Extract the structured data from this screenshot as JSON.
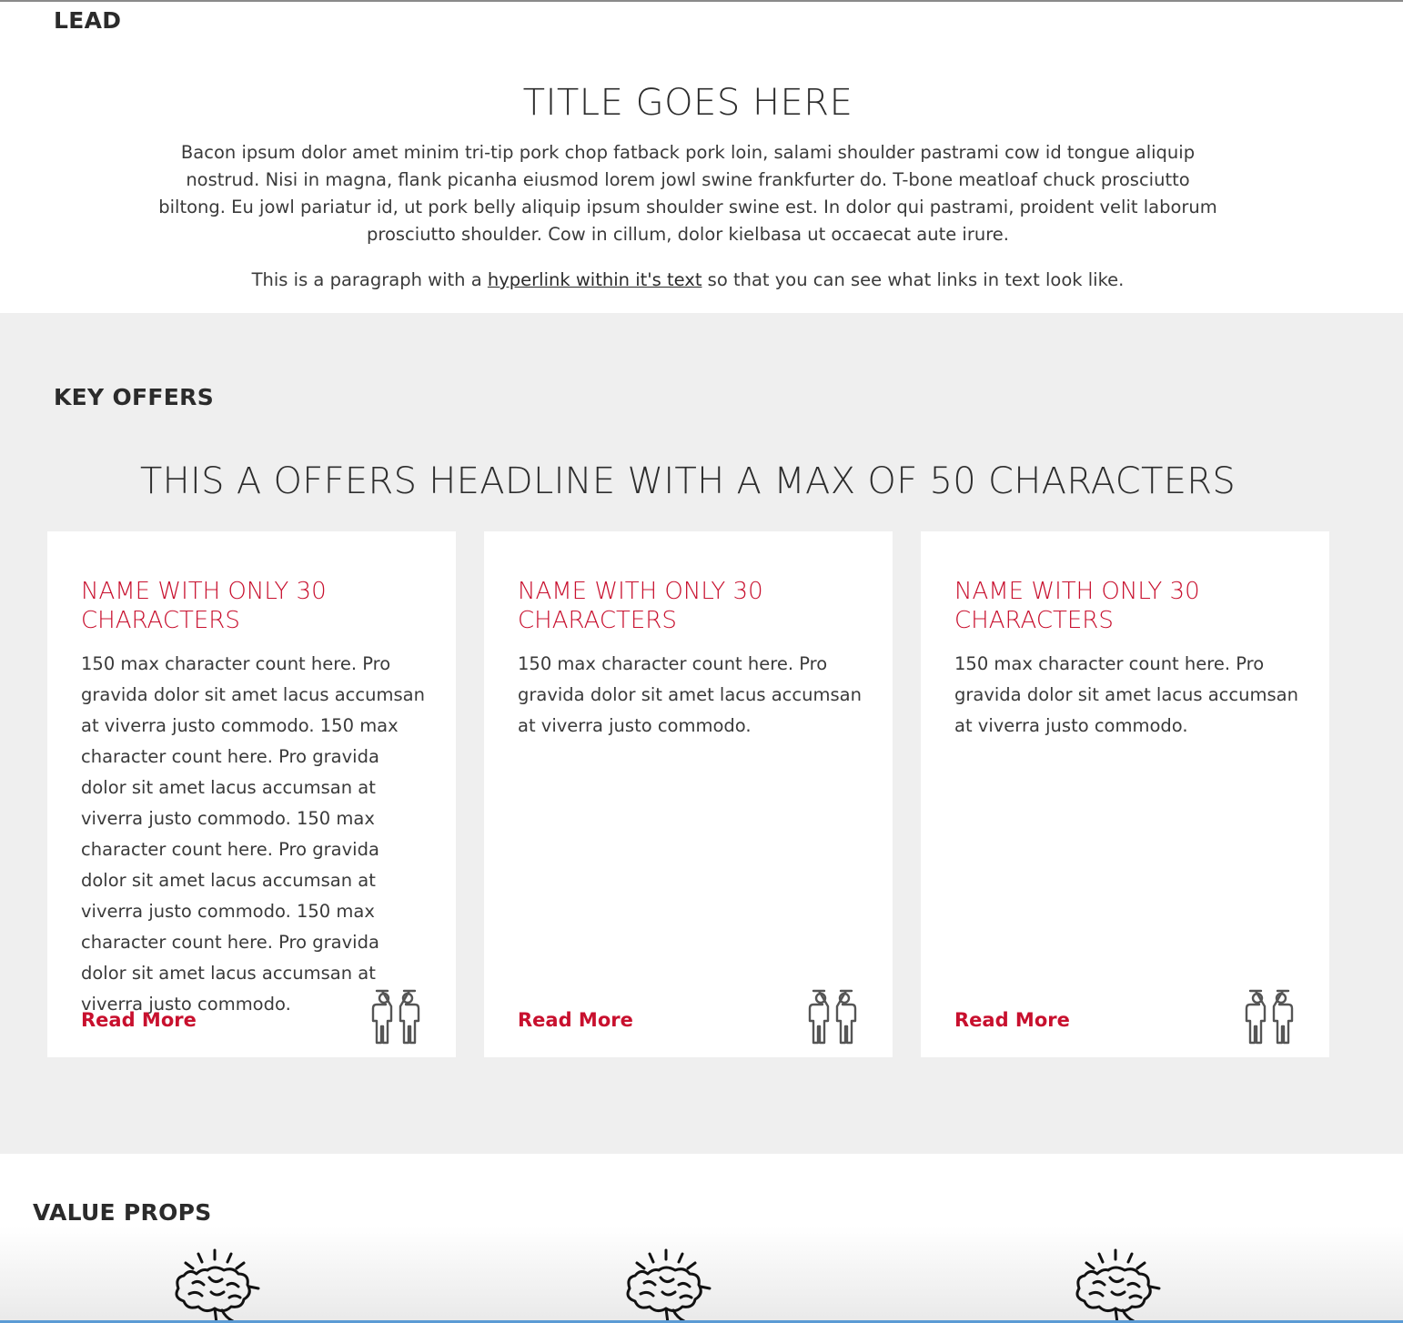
{
  "lead": {
    "label": "LEAD",
    "title": "TITLE GOES HERE",
    "body": "Bacon ipsum dolor amet minim tri-tip pork chop fatback pork loin, salami shoulder pastrami cow id tongue aliquip nostrud. Nisi in magna, flank picanha eiusmod lorem jowl swine frankfurter do. T-bone meatloaf chuck prosciutto biltong. Eu jowl pariatur id, ut pork belly aliquip ipsum shoulder swine est. In dolor qui pastrami, proident velit laborum prosciutto shoulder. Cow in cillum, dolor kielbasa ut occaecat aute irure.",
    "para2_before": "This is a paragraph with a ",
    "para2_link": "hyperlink within it's text",
    "para2_after": " so that you can see what links in text look like."
  },
  "offers": {
    "label": "KEY OFFERS",
    "headline": "THIS A OFFERS HEADLINE WITH A MAX OF 50 CHARACTERS",
    "cards": [
      {
        "name": "NAME WITH ONLY 30 CHARACTERS",
        "description": "150 max character count here. Pro gravida dolor sit amet lacus accumsan at viverra justo commodo. 150 max character count here. Pro gravida dolor sit amet lacus accumsan at viverra justo commodo. 150 max character count here. Pro gravida dolor sit amet lacus accumsan at viverra justo commodo. 150 max character count here. Pro gravida dolor sit amet lacus accumsan at viverra justo commodo.",
        "link": "Read More",
        "icon": "high-five-icon"
      },
      {
        "name": "NAME WITH ONLY 30 CHARACTERS",
        "description": "150 max character count here. Pro gravida dolor sit amet lacus accumsan at viverra justo commodo.",
        "link": "Read More",
        "icon": "high-five-icon"
      },
      {
        "name": "NAME WITH ONLY 30 CHARACTERS",
        "description": "150 max character count here. Pro gravida dolor sit amet lacus accumsan at viverra justo commodo.",
        "link": "Read More",
        "icon": "high-five-icon"
      }
    ]
  },
  "values": {
    "label": "VALUE PROPS",
    "icons": [
      "brain-idea-icon",
      "brain-idea-icon",
      "brain-idea-icon"
    ]
  },
  "colors": {
    "accent": "#c8102e",
    "offers_background": "#efefef",
    "text": "#333333"
  }
}
